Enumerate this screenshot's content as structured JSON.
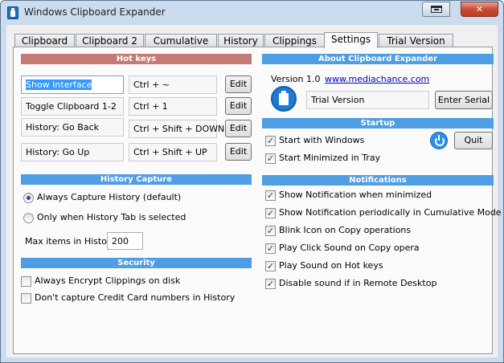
{
  "window": {
    "title": "Windows Clipboard Expander",
    "close_glyph": "✕"
  },
  "tabs": [
    "Clipboard",
    "Clipboard 2",
    "Cumulative",
    "History",
    "Clippings",
    "Settings",
    "Trial Version"
  ],
  "active_tab": "Settings",
  "hotkeys": {
    "header": "Hot keys",
    "rows": [
      {
        "action": "Show Interface",
        "keys": "Ctrl + ~",
        "button": "Edit"
      },
      {
        "action": "Toggle Clipboard 1-2",
        "keys": "Ctrl + 1",
        "button": "Edit"
      },
      {
        "action": "History: Go Back",
        "keys": "Ctrl + Shift + DOWN",
        "button": "Edit"
      },
      {
        "action": "History: Go Up",
        "keys": "Ctrl + Shift + UP",
        "button": "Edit"
      }
    ]
  },
  "history_capture": {
    "header": "History Capture",
    "option_always": "Always Capture History (default)",
    "option_tab": "Only when History Tab is selected",
    "selected": "always",
    "max_label": "Max items in History",
    "max_value": "200"
  },
  "security": {
    "header": "Security",
    "encrypt": {
      "label": "Always Encrypt Clippings on disk",
      "checked": false
    },
    "credit_card": {
      "label": "Don't capture Credit Card numbers in History",
      "checked": false
    }
  },
  "about": {
    "header": "About Clipboard Expander",
    "version": "Version 1.0",
    "link": "www.mediachance.com",
    "license": "Trial Version",
    "serial_button": "Enter Serial"
  },
  "startup": {
    "header": "Startup",
    "start_windows": {
      "label": "Start with Windows",
      "checked": true
    },
    "start_minimized": {
      "label": "Start Minimized in Tray",
      "checked": true
    },
    "quit_button": "Quit"
  },
  "notifications": {
    "header": "Notifications",
    "items": [
      {
        "label": "Show Notification when minimized",
        "checked": true
      },
      {
        "label": "Show Notification periodically in Cumulative Mode",
        "checked": true
      },
      {
        "label": "Blink Icon on Copy operations",
        "checked": true
      },
      {
        "label": "Play Click Sound on Copy opera",
        "checked": true
      },
      {
        "label": "Play Sound on Hot keys",
        "checked": true
      },
      {
        "label": "Disable sound if in Remote Desktop",
        "checked": true
      }
    ]
  },
  "check_glyph": "✓",
  "colors": {
    "hotkeys_header": "#c57b75",
    "section_header": "#4f9de3",
    "link": "#0000cc"
  }
}
